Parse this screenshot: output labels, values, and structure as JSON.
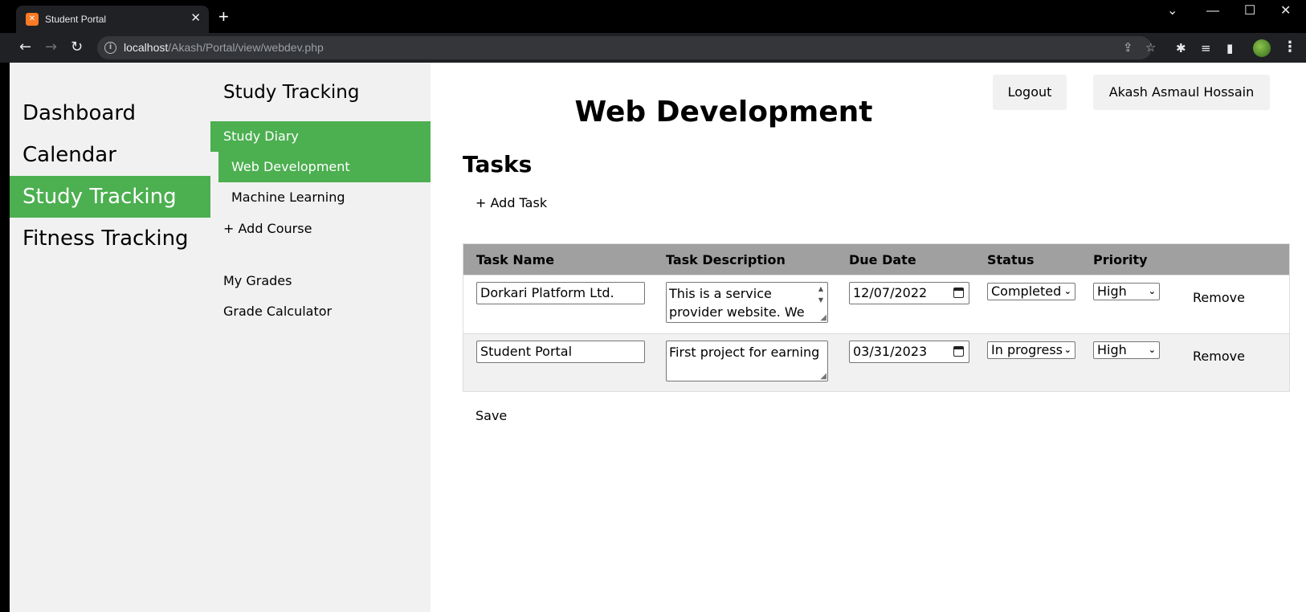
{
  "browser": {
    "tab_title": "Student Portal",
    "url_host": "localhost",
    "url_path": "/Akash/Portal/view/webdev.php"
  },
  "sidebar": {
    "items": [
      {
        "label": "Dashboard"
      },
      {
        "label": "Calendar"
      },
      {
        "label": "Study Tracking",
        "active": true
      },
      {
        "label": "Fitness Tracking"
      }
    ]
  },
  "subnav": {
    "title": "Study Tracking",
    "study_diary": "Study Diary",
    "courses": [
      {
        "label": "Web Development",
        "active": true
      },
      {
        "label": "Machine Learning"
      }
    ],
    "add_course": "+ Add Course",
    "my_grades": "My Grades",
    "grade_calculator": "Grade Calculator"
  },
  "header": {
    "logout": "Logout",
    "user_name": "Akash Asmaul Hossain"
  },
  "main": {
    "title": "Web Development",
    "tasks_heading": "Tasks",
    "add_task": "+ Add Task",
    "save": "Save",
    "columns": [
      "Task Name",
      "Task Description",
      "Due Date",
      "Status",
      "Priority"
    ],
    "rows": [
      {
        "name": "Dorkari Platform Ltd.",
        "description": "This is a service provider website. We",
        "due_date": "12/07/2022",
        "status": "Completed",
        "priority": "High",
        "remove": "Remove"
      },
      {
        "name": "Student Portal",
        "description": "First project for earning",
        "due_date": "03/31/2023",
        "status": "In progress",
        "priority": "High",
        "remove": "Remove"
      }
    ]
  },
  "colors": {
    "accent_green": "#4caf50",
    "sidebar_bg": "#f1f1f1",
    "table_header_bg": "#a0a0a0"
  }
}
